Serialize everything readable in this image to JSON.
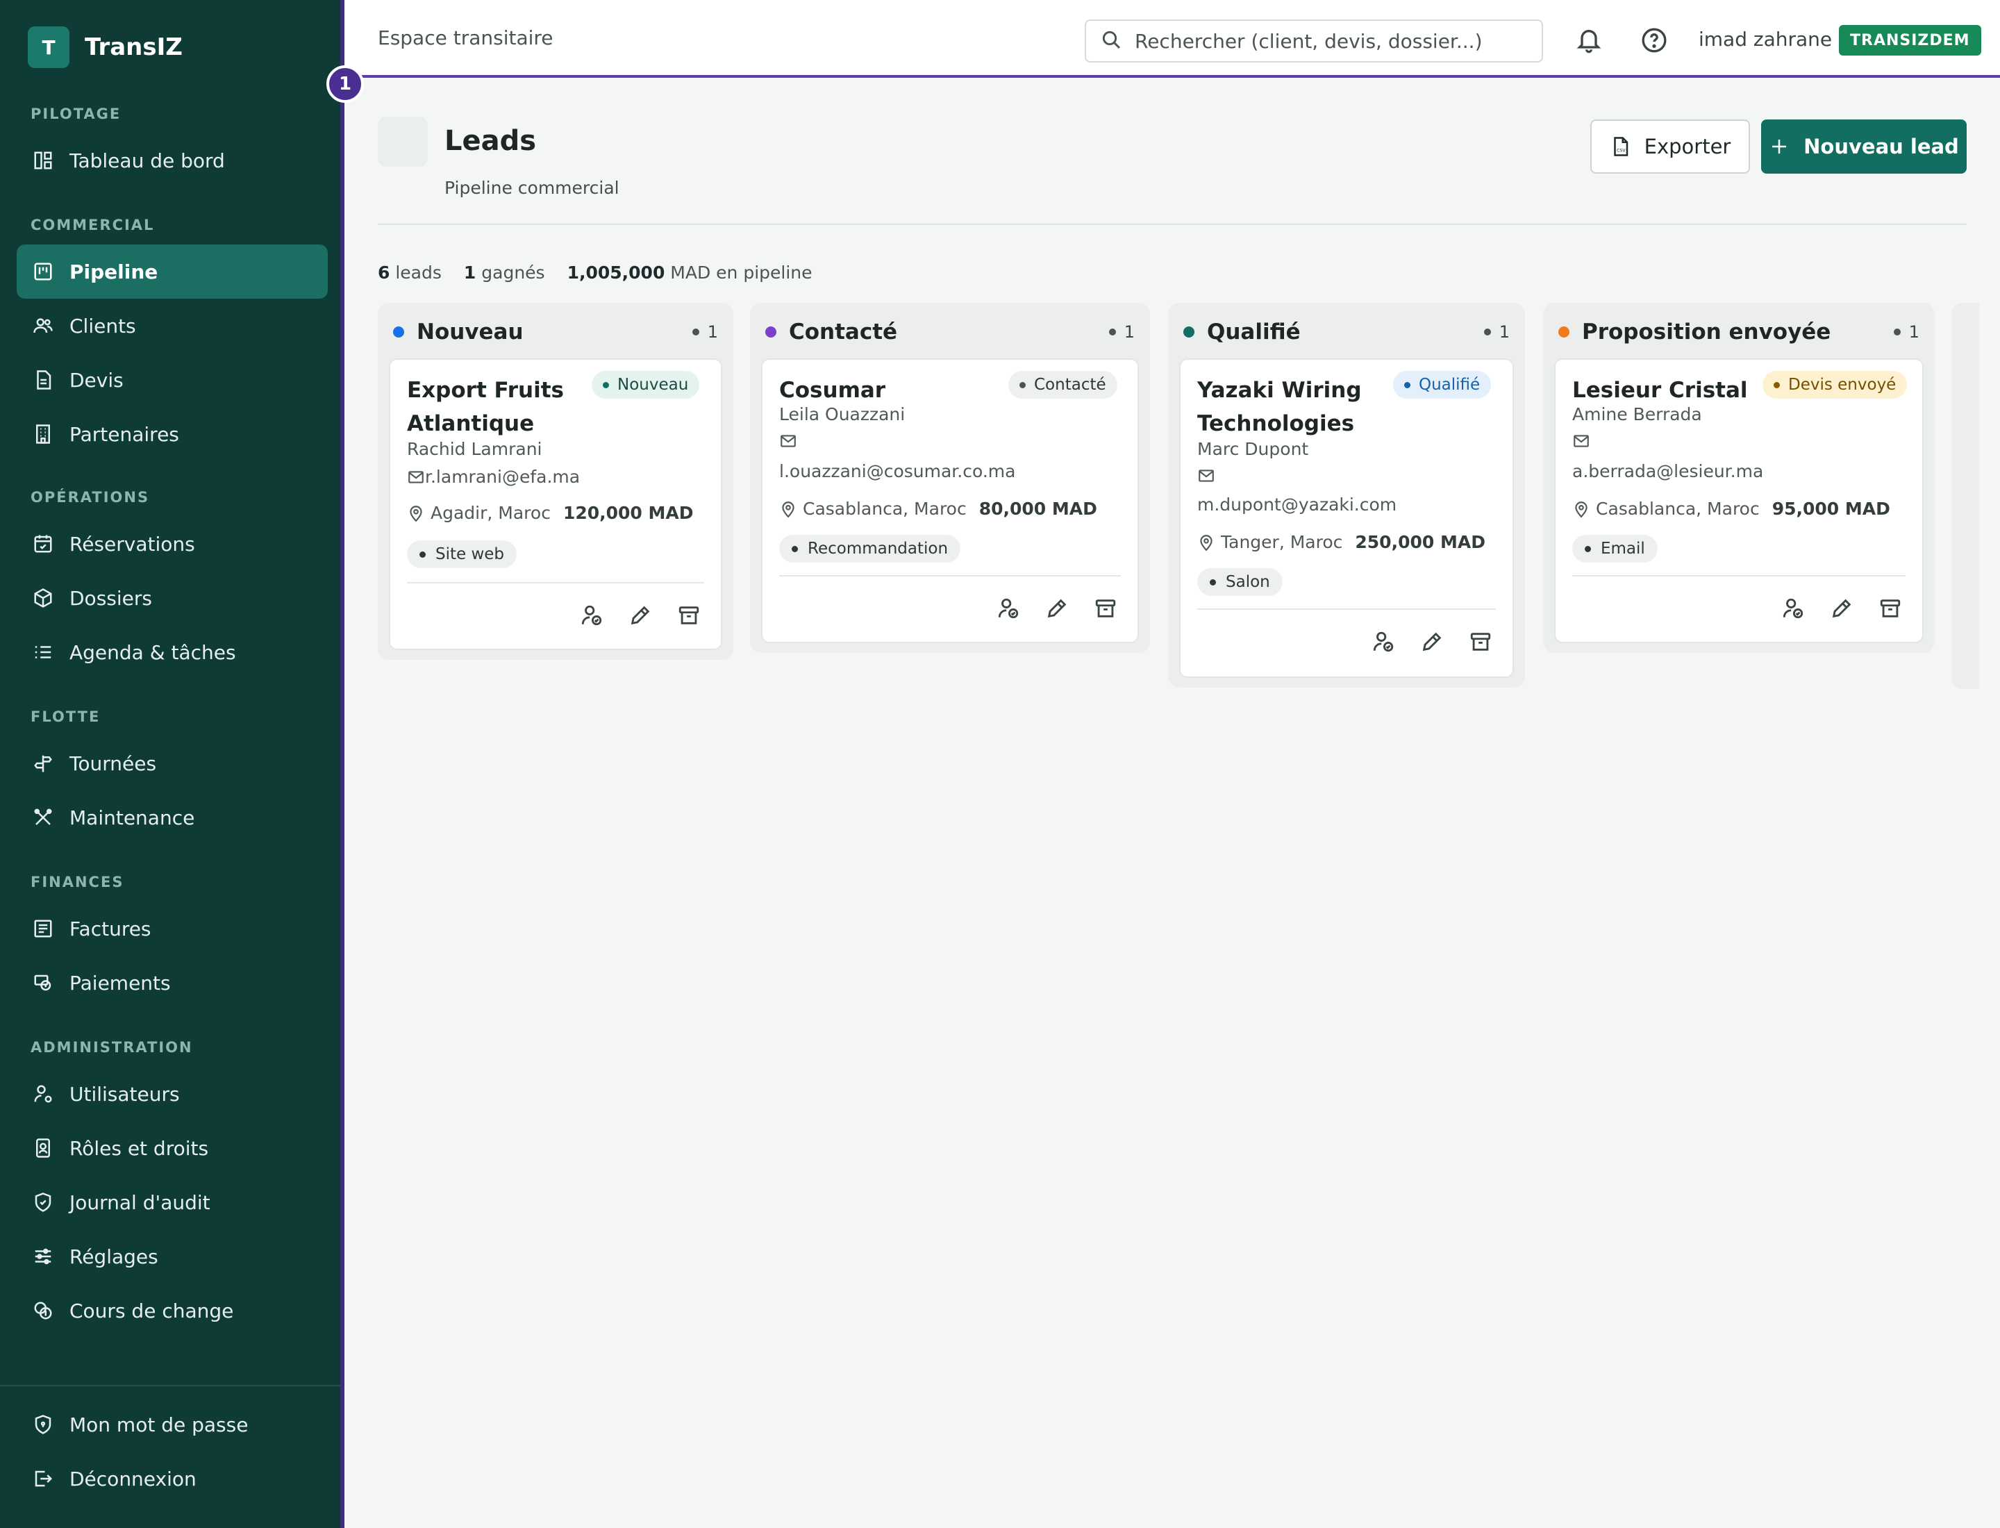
{
  "brand": {
    "logo_letter": "T",
    "name": "TransIZ"
  },
  "sidebar": {
    "sections": {
      "pilotage": "PILOTAGE",
      "commercial": "COMMERCIAL",
      "operations": "OPÉRATIONS",
      "flotte": "FLOTTE",
      "finances": "FINANCES",
      "administration": "ADMINISTRATION"
    },
    "items": {
      "dashboard": "Tableau de bord",
      "pipeline": "Pipeline",
      "clients": "Clients",
      "devis": "Devis",
      "partenaires": "Partenaires",
      "reservations": "Réservations",
      "dossiers": "Dossiers",
      "agenda": "Agenda & tâches",
      "tournees": "Tournées",
      "maintenance": "Maintenance",
      "factures": "Factures",
      "paiements": "Paiements",
      "utilisateurs": "Utilisateurs",
      "roles": "Rôles et droits",
      "audit": "Journal d'audit",
      "reglages": "Réglages",
      "change": "Cours de change",
      "password": "Mon mot de passe",
      "logout": "Déconnexion"
    }
  },
  "header": {
    "workspace": "Espace transitaire",
    "search_placeholder": "Rechercher (client, devis, dossier...)",
    "username": "imad zahrane",
    "tenant": "TRANSIZDEM",
    "step": "1"
  },
  "page": {
    "title": "Leads",
    "subtitle": "Pipeline commercial",
    "export_label": "Exporter",
    "new_label": "Nouveau lead"
  },
  "stats": {
    "leads_count": "6",
    "leads_label": "leads",
    "won_count": "1",
    "won_label": "gagnés",
    "pipeline_value": "1,005,000",
    "pipeline_label": "MAD en pipeline"
  },
  "columns": [
    {
      "title": "Nouveau",
      "count": "1",
      "color": "#1a6fe8",
      "card": {
        "name_line1": "Export Fruits",
        "name_line2": "Atlantique",
        "status": "Nouveau",
        "contact": "Rachid Lamrani",
        "email": "r.lamrani@efa.ma",
        "location": "Agadir, Maroc",
        "amount": "120,000 MAD",
        "source": "Site web"
      }
    },
    {
      "title": "Contacté",
      "count": "1",
      "color": "#7a3fcf",
      "card": {
        "name_line1": "Cosumar",
        "status": "Contacté",
        "contact": "Leila Ouazzani",
        "email": "l.ouazzani@cosumar.co.ma",
        "location": "Casablanca, Maroc",
        "amount": "80,000 MAD",
        "source": "Recommandation"
      }
    },
    {
      "title": "Qualifié",
      "count": "1",
      "color": "#136e62",
      "card": {
        "name_line1": "Yazaki Wiring",
        "name_line2": "Technologies",
        "status": "Qualifié",
        "contact": "Marc Dupont",
        "email": "m.dupont@yazaki.com",
        "location": "Tanger, Maroc",
        "amount": "250,000 MAD",
        "source": "Salon"
      }
    },
    {
      "title": "Proposition envoyée",
      "count": "1",
      "color": "#f07a1a",
      "card": {
        "name_line1": "Lesieur Cristal",
        "status": "Devis envoyé",
        "contact": "Amine Berrada",
        "email": "a.berrada@lesieur.ma",
        "location": "Casablanca, Maroc",
        "amount": "95,000 MAD",
        "source": "Email"
      }
    }
  ]
}
